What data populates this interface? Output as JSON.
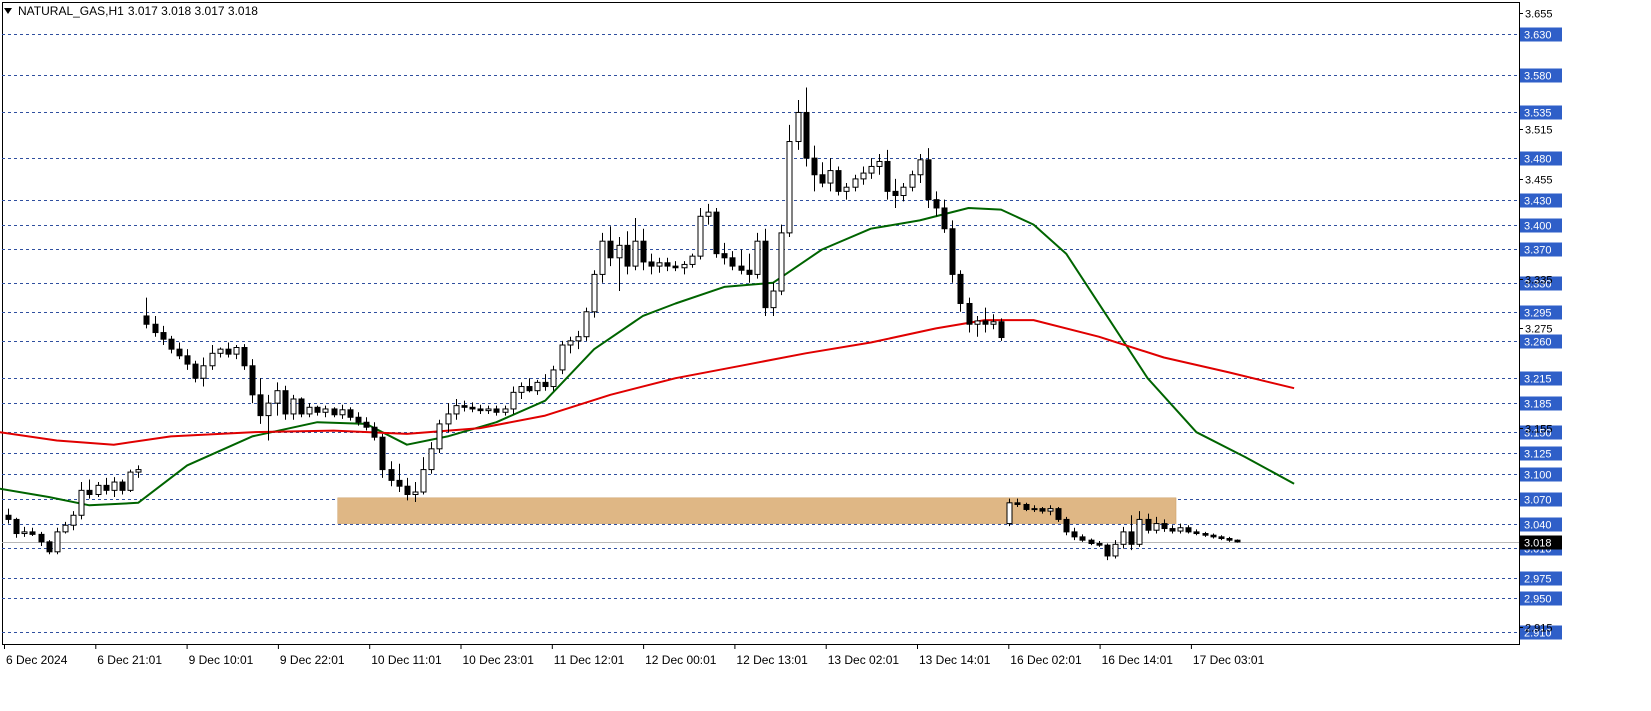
{
  "header": {
    "symbol": "NATURAL_GAS,H1",
    "ohlc": "3.017 3.018 3.017 3.018"
  },
  "colors": {
    "background": "#ffffff",
    "grid": "#2f4f9f",
    "bull_body": "#ffffff",
    "bear_body": "#000000",
    "ma_fast": "#006400",
    "ma_slow": "#e00000",
    "zone": "#dfb785",
    "price_label_bg": "#2f5fc8",
    "current_price_bg": "#000000"
  },
  "chart_data": {
    "type": "candlestick",
    "ylim": [
      2.895,
      3.668
    ],
    "price_levels": [
      "3.630",
      "3.580",
      "3.535",
      "3.480",
      "3.430",
      "3.400",
      "3.370",
      "3.330",
      "3.295",
      "3.260",
      "3.215",
      "3.185",
      "3.150",
      "3.125",
      "3.100",
      "3.070",
      "3.040",
      "3.010",
      "2.975",
      "2.950",
      "2.910"
    ],
    "scale_ticks": [
      "3.655",
      "3.515",
      "3.455",
      "3.335",
      "3.275",
      "3.155",
      "2.915"
    ],
    "current_price": "3.018",
    "x_labels": [
      "6 Dec 2024",
      "6 Dec 21:01",
      "9 Dec 10:01",
      "9 Dec 22:01",
      "10 Dec 11:01",
      "10 Dec 23:01",
      "11 Dec 12:01",
      "12 Dec 00:01",
      "12 Dec 13:01",
      "13 Dec 02:01",
      "13 Dec 14:01",
      "16 Dec 02:01",
      "16 Dec 14:01",
      "17 Dec 03:01"
    ],
    "zone": {
      "index_from": 41,
      "index_to": 143,
      "price_low": 3.04,
      "price_high": 3.071
    },
    "candles": [
      [
        3.05,
        3.058,
        3.04,
        3.045
      ],
      [
        3.045,
        3.047,
        3.023,
        3.028
      ],
      [
        3.028,
        3.036,
        3.024,
        3.03
      ],
      [
        3.03,
        3.035,
        3.025,
        3.027
      ],
      [
        3.027,
        3.03,
        3.013,
        3.018
      ],
      [
        3.018,
        3.02,
        3.003,
        3.006
      ],
      [
        3.006,
        3.035,
        3.003,
        3.03
      ],
      [
        3.03,
        3.042,
        3.028,
        3.038
      ],
      [
        3.038,
        3.055,
        3.032,
        3.05
      ],
      [
        3.05,
        3.09,
        3.045,
        3.08
      ],
      [
        3.08,
        3.093,
        3.07,
        3.075
      ],
      [
        3.075,
        3.09,
        3.072,
        3.086
      ],
      [
        3.086,
        3.095,
        3.075,
        3.08
      ],
      [
        3.08,
        3.096,
        3.072,
        3.09
      ],
      [
        3.09,
        3.093,
        3.075,
        3.08
      ],
      [
        3.08,
        3.105,
        3.078,
        3.102
      ],
      [
        3.102,
        3.11,
        3.095,
        3.105
      ],
      [
        3.29,
        3.312,
        3.275,
        3.28
      ],
      [
        3.28,
        3.29,
        3.265,
        3.27
      ],
      [
        3.27,
        3.278,
        3.255,
        3.262
      ],
      [
        3.262,
        3.266,
        3.245,
        3.25
      ],
      [
        3.25,
        3.258,
        3.238,
        3.242
      ],
      [
        3.242,
        3.25,
        3.225,
        3.232
      ],
      [
        3.232,
        3.236,
        3.21,
        3.215
      ],
      [
        3.215,
        3.24,
        3.205,
        3.23
      ],
      [
        3.23,
        3.255,
        3.225,
        3.245
      ],
      [
        3.245,
        3.252,
        3.24,
        3.25
      ],
      [
        3.25,
        3.258,
        3.24,
        3.244
      ],
      [
        3.244,
        3.255,
        3.238,
        3.252
      ],
      [
        3.252,
        3.256,
        3.225,
        3.23
      ],
      [
        3.23,
        3.238,
        3.185,
        3.195
      ],
      [
        3.195,
        3.215,
        3.16,
        3.17
      ],
      [
        3.17,
        3.195,
        3.14,
        3.185
      ],
      [
        3.185,
        3.21,
        3.17,
        3.2
      ],
      [
        3.2,
        3.206,
        3.165,
        3.172
      ],
      [
        3.172,
        3.195,
        3.165,
        3.19
      ],
      [
        3.19,
        3.192,
        3.168,
        3.172
      ],
      [
        3.172,
        3.185,
        3.168,
        3.18
      ],
      [
        3.18,
        3.182,
        3.17,
        3.174
      ],
      [
        3.174,
        3.182,
        3.168,
        3.178
      ],
      [
        3.178,
        3.18,
        3.168,
        3.171
      ],
      [
        3.171,
        3.183,
        3.166,
        3.177
      ],
      [
        3.177,
        3.18,
        3.164,
        3.168
      ],
      [
        3.168,
        3.174,
        3.158,
        3.162
      ],
      [
        3.162,
        3.168,
        3.152,
        3.156
      ],
      [
        3.156,
        3.162,
        3.14,
        3.144
      ],
      [
        3.144,
        3.148,
        3.095,
        3.105
      ],
      [
        3.105,
        3.115,
        3.085,
        3.092
      ],
      [
        3.092,
        3.112,
        3.078,
        3.085
      ],
      [
        3.085,
        3.095,
        3.068,
        3.075
      ],
      [
        3.075,
        3.09,
        3.066,
        3.078
      ],
      [
        3.078,
        3.12,
        3.075,
        3.105
      ],
      [
        3.105,
        3.138,
        3.1,
        3.13
      ],
      [
        3.13,
        3.165,
        3.125,
        3.16
      ],
      [
        3.16,
        3.185,
        3.15,
        3.172
      ],
      [
        3.172,
        3.19,
        3.165,
        3.182
      ],
      [
        3.182,
        3.188,
        3.175,
        3.18
      ],
      [
        3.18,
        3.186,
        3.174,
        3.178
      ],
      [
        3.178,
        3.183,
        3.172,
        3.176
      ],
      [
        3.176,
        3.182,
        3.172,
        3.178
      ],
      [
        3.178,
        3.182,
        3.17,
        3.174
      ],
      [
        3.174,
        3.182,
        3.17,
        3.178
      ],
      [
        3.178,
        3.205,
        3.172,
        3.198
      ],
      [
        3.198,
        3.21,
        3.19,
        3.205
      ],
      [
        3.205,
        3.215,
        3.198,
        3.2
      ],
      [
        3.2,
        3.213,
        3.195,
        3.21
      ],
      [
        3.21,
        3.22,
        3.2,
        3.205
      ],
      [
        3.205,
        3.23,
        3.2,
        3.225
      ],
      [
        3.225,
        3.26,
        3.22,
        3.255
      ],
      [
        3.255,
        3.265,
        3.245,
        3.26
      ],
      [
        3.26,
        3.272,
        3.25,
        3.265
      ],
      [
        3.265,
        3.3,
        3.26,
        3.295
      ],
      [
        3.295,
        3.345,
        3.288,
        3.34
      ],
      [
        3.34,
        3.39,
        3.33,
        3.38
      ],
      [
        3.38,
        3.398,
        3.35,
        3.36
      ],
      [
        3.36,
        3.385,
        3.32,
        3.375
      ],
      [
        3.375,
        3.392,
        3.34,
        3.35
      ],
      [
        3.35,
        3.408,
        3.345,
        3.38
      ],
      [
        3.38,
        3.395,
        3.345,
        3.355
      ],
      [
        3.355,
        3.365,
        3.34,
        3.35
      ],
      [
        3.35,
        3.36,
        3.342,
        3.354
      ],
      [
        3.354,
        3.36,
        3.344,
        3.35
      ],
      [
        3.35,
        3.356,
        3.344,
        3.348
      ],
      [
        3.348,
        3.356,
        3.34,
        3.352
      ],
      [
        3.352,
        3.365,
        3.348,
        3.362
      ],
      [
        3.362,
        3.42,
        3.358,
        3.41
      ],
      [
        3.41,
        3.425,
        3.4,
        3.415
      ],
      [
        3.415,
        3.42,
        3.36,
        3.365
      ],
      [
        3.365,
        3.378,
        3.352,
        3.36
      ],
      [
        3.36,
        3.368,
        3.345,
        3.35
      ],
      [
        3.35,
        3.37,
        3.34,
        3.345
      ],
      [
        3.345,
        3.365,
        3.33,
        3.34
      ],
      [
        3.34,
        3.39,
        3.335,
        3.38
      ],
      [
        3.38,
        3.395,
        3.29,
        3.3
      ],
      [
        3.3,
        3.33,
        3.29,
        3.32
      ],
      [
        3.32,
        3.4,
        3.315,
        3.39
      ],
      [
        3.39,
        3.52,
        3.385,
        3.5
      ],
      [
        3.5,
        3.55,
        3.49,
        3.535
      ],
      [
        3.535,
        3.565,
        3.47,
        3.48
      ],
      [
        3.48,
        3.495,
        3.44,
        3.46
      ],
      [
        3.46,
        3.475,
        3.445,
        3.45
      ],
      [
        3.45,
        3.48,
        3.44,
        3.465
      ],
      [
        3.465,
        3.47,
        3.435,
        3.44
      ],
      [
        3.44,
        3.45,
        3.43,
        3.445
      ],
      [
        3.445,
        3.46,
        3.44,
        3.455
      ],
      [
        3.455,
        3.47,
        3.448,
        3.462
      ],
      [
        3.462,
        3.48,
        3.455,
        3.47
      ],
      [
        3.47,
        3.485,
        3.46,
        3.476
      ],
      [
        3.476,
        3.49,
        3.43,
        3.44
      ],
      [
        3.44,
        3.455,
        3.42,
        3.435
      ],
      [
        3.435,
        3.45,
        3.428,
        3.445
      ],
      [
        3.445,
        3.465,
        3.44,
        3.46
      ],
      [
        3.46,
        3.485,
        3.45,
        3.478
      ],
      [
        3.478,
        3.492,
        3.42,
        3.43
      ],
      [
        3.43,
        3.44,
        3.41,
        3.42
      ],
      [
        3.42,
        3.43,
        3.39,
        3.395
      ],
      [
        3.395,
        3.405,
        3.33,
        3.34
      ],
      [
        3.34,
        3.345,
        3.295,
        3.305
      ],
      [
        3.305,
        3.312,
        3.27,
        3.28
      ],
      [
        3.28,
        3.29,
        3.265,
        3.284
      ],
      [
        3.284,
        3.3,
        3.27,
        3.28
      ],
      [
        3.28,
        3.292,
        3.274,
        3.283
      ],
      [
        3.283,
        3.287,
        3.26,
        3.264
      ],
      [
        3.04,
        3.07,
        3.037,
        3.065
      ],
      [
        3.065,
        3.07,
        3.06,
        3.063
      ],
      [
        3.063,
        3.065,
        3.055,
        3.057
      ],
      [
        3.057,
        3.062,
        3.054,
        3.058
      ],
      [
        3.058,
        3.06,
        3.052,
        3.055
      ],
      [
        3.055,
        3.062,
        3.05,
        3.058
      ],
      [
        3.058,
        3.06,
        3.042,
        3.045
      ],
      [
        3.045,
        3.048,
        3.026,
        3.03
      ],
      [
        3.03,
        3.035,
        3.02,
        3.024
      ],
      [
        3.024,
        3.027,
        3.018,
        3.02
      ],
      [
        3.02,
        3.022,
        3.014,
        3.016
      ],
      [
        3.016,
        3.019,
        3.012,
        3.014
      ],
      [
        3.014,
        3.016,
        2.996,
        3.001
      ],
      [
        3.001,
        3.02,
        2.998,
        3.015
      ],
      [
        3.015,
        3.036,
        3.01,
        3.03
      ],
      [
        3.03,
        3.05,
        3.008,
        3.015
      ],
      [
        3.015,
        3.055,
        3.012,
        3.045
      ],
      [
        3.045,
        3.052,
        3.028,
        3.032
      ],
      [
        3.032,
        3.048,
        3.028,
        3.04
      ],
      [
        3.04,
        3.045,
        3.03,
        3.034
      ],
      [
        3.034,
        3.038,
        3.028,
        3.031
      ],
      [
        3.031,
        3.04,
        3.028,
        3.035
      ],
      [
        3.035,
        3.038,
        3.028,
        3.03
      ],
      [
        3.03,
        3.033,
        3.026,
        3.028
      ],
      [
        3.028,
        3.03,
        3.024,
        3.026
      ],
      [
        3.026,
        3.028,
        3.022,
        3.024
      ],
      [
        3.024,
        3.026,
        3.02,
        3.022
      ],
      [
        3.022,
        3.024,
        3.018,
        3.02
      ],
      [
        3.02,
        3.021,
        3.017,
        3.018
      ]
    ],
    "series": [
      {
        "name": "",
        "color": "#006400",
        "points": [
          [
            -1,
            3.082
          ],
          [
            5,
            3.072
          ],
          [
            10,
            3.062
          ],
          [
            16,
            3.065
          ],
          [
            22,
            3.11
          ],
          [
            30,
            3.145
          ],
          [
            38,
            3.162
          ],
          [
            44,
            3.16
          ],
          [
            49,
            3.135
          ],
          [
            54,
            3.145
          ],
          [
            60,
            3.162
          ],
          [
            66,
            3.188
          ],
          [
            72,
            3.25
          ],
          [
            78,
            3.29
          ],
          [
            82,
            3.305
          ],
          [
            88,
            3.325
          ],
          [
            94,
            3.33
          ],
          [
            100,
            3.37
          ],
          [
            106,
            3.395
          ],
          [
            112,
            3.405
          ],
          [
            118,
            3.42
          ],
          [
            122,
            3.418
          ],
          [
            126,
            3.4
          ],
          [
            130,
            3.365
          ],
          [
            135,
            3.29
          ],
          [
            140,
            3.215
          ],
          [
            146,
            3.15
          ],
          [
            152,
            3.12
          ],
          [
            158,
            3.088
          ]
        ]
      },
      {
        "name": "",
        "color": "#e00000",
        "points": [
          [
            -1,
            3.15
          ],
          [
            6,
            3.14
          ],
          [
            13,
            3.135
          ],
          [
            20,
            3.145
          ],
          [
            30,
            3.15
          ],
          [
            40,
            3.152
          ],
          [
            49,
            3.148
          ],
          [
            58,
            3.155
          ],
          [
            66,
            3.17
          ],
          [
            74,
            3.195
          ],
          [
            82,
            3.215
          ],
          [
            90,
            3.23
          ],
          [
            98,
            3.245
          ],
          [
            106,
            3.258
          ],
          [
            114,
            3.275
          ],
          [
            120,
            3.285
          ],
          [
            126,
            3.285
          ],
          [
            134,
            3.265
          ],
          [
            142,
            3.24
          ],
          [
            150,
            3.222
          ],
          [
            158,
            3.203
          ]
        ]
      }
    ]
  }
}
